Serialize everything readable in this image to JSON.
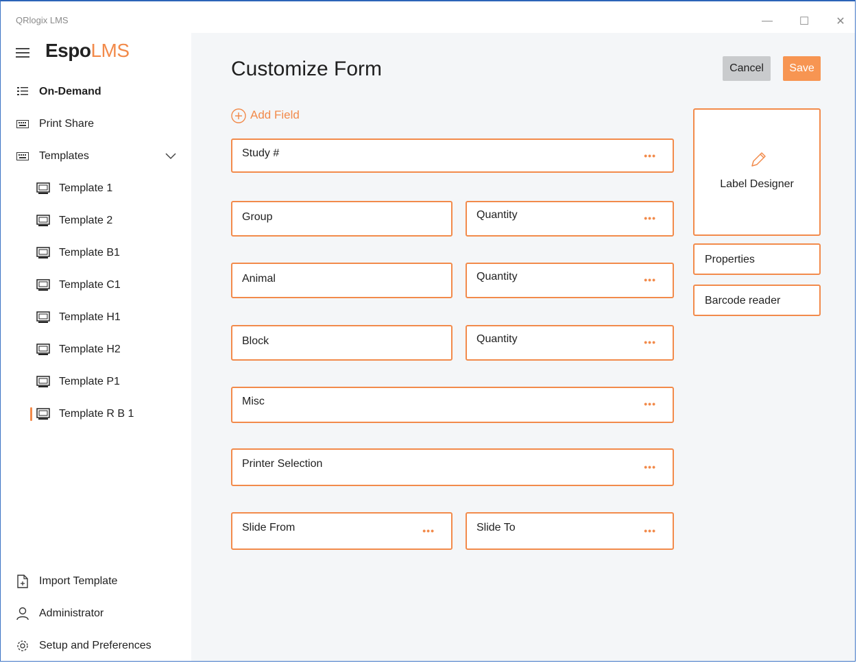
{
  "window": {
    "app_title": "QRlogix LMS",
    "controls": {
      "minimize": "—",
      "maximize": "☐",
      "close": "✕"
    }
  },
  "sidebar": {
    "logo_bold": "Espo",
    "logo_accent": "LMS",
    "top_items": [
      {
        "label": "On-Demand",
        "icon": "list-icon"
      },
      {
        "label": "Print Share",
        "icon": "keyboard-icon"
      },
      {
        "label": "Templates",
        "icon": "keyboard-icon"
      }
    ],
    "templates": [
      {
        "label": "Template 1"
      },
      {
        "label": "Template 2"
      },
      {
        "label": "Template B1"
      },
      {
        "label": "Template C1"
      },
      {
        "label": "Template H1"
      },
      {
        "label": "Template H2"
      },
      {
        "label": "Template P1"
      },
      {
        "label": "Template R B 1"
      }
    ],
    "bottom_items": [
      {
        "label": "Import Template",
        "icon": "document-icon"
      },
      {
        "label": "Administrator",
        "icon": "user-icon"
      },
      {
        "label": "Setup and Preferences",
        "icon": "gear-icon"
      }
    ]
  },
  "main": {
    "title": "Customize Form",
    "cancel_label": "Cancel",
    "save_label": "Save",
    "add_field_label": "Add Field",
    "more_glyph": "•••",
    "fields": {
      "study": "Study #",
      "group": "Group",
      "group_qty": "Quantity",
      "animal": "Animal",
      "animal_qty": "Quantity",
      "block": "Block",
      "block_qty": "Quantity",
      "misc": "Misc",
      "printer": "Printer Selection",
      "slide_from": "Slide From",
      "slide_to": "Slide To"
    },
    "side_panel": {
      "label_designer": "Label Designer",
      "properties": "Properties",
      "barcode_reader": "Barcode reader"
    }
  },
  "colors": {
    "accent": "#f28a4a",
    "save_bg": "#f79552",
    "cancel_bg": "#c9cbcd",
    "main_bg": "#f4f6f8"
  }
}
